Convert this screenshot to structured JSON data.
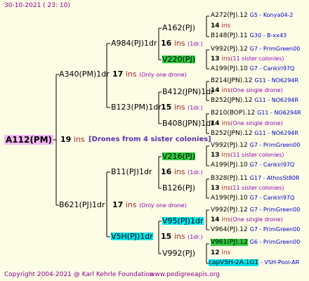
{
  "header": "30-10-2021 ( 23: 10)",
  "footer": {
    "copyright": "Copyright 2004-2021 @ Karl Kehrle Foundation",
    "site": "www.pedigreeapis.org"
  },
  "root": {
    "name": "A112(PM)",
    "inbreed": "19",
    "ins": "ins",
    "desc": "[Drones from 4 sister colonies]"
  },
  "gen1": {
    "top": {
      "name": "A340(PM)1dr",
      "inbreed": "17",
      "ins": "ins",
      "desc": "(Only one drone)"
    },
    "bottom": {
      "name": "B621(PJ)1dr",
      "inbreed": "17",
      "ins": "ins",
      "desc": "(Only one drone)"
    }
  },
  "gen2": {
    "a": {
      "name": "A984(PJ)1dr",
      "inbreed": "16",
      "ins": "ins",
      "desc": "(1dr.)"
    },
    "b": {
      "name": "B123(PM)1dr",
      "inbreed": "15",
      "ins": "ins",
      "desc": "(1dr.)"
    },
    "c": {
      "name": "B11(PJ)1dr",
      "inbreed": "16",
      "ins": "ins",
      "desc": "(1dr.)"
    },
    "d": {
      "name": "V5H(PJ)1dr",
      "inbreed": "15",
      "ins": "ins",
      "desc": "(1dr.)"
    }
  },
  "gen3": [
    {
      "name": "A162(PJ)"
    },
    {
      "name": "V220(PJ)"
    },
    {
      "name": "B412(JPN)1dr"
    },
    {
      "name": "B408(JPN)1dr"
    },
    {
      "name": "V216(PJ)"
    },
    {
      "name": "B126(PJ)"
    },
    {
      "name": "V95(PJ)1dr"
    },
    {
      "name": "V992(PJ)"
    }
  ],
  "gen4": [
    {
      "name": "A272(PJ).12",
      "extra": "G5 - Konya04-2"
    },
    {
      "inbreed": "14",
      "ins": "ins"
    },
    {
      "name": "B148(PJ).11",
      "extra": "G30 - B-xx43"
    },
    {
      "name": "V992(PJ).12",
      "extra": "G7 - PrimGreen00"
    },
    {
      "inbreed": "13",
      "ins": "ins",
      "note": "(11 sister colonies)"
    },
    {
      "name": "A199(PJ).10",
      "extra": "G7 - Cankiri97Q"
    },
    {
      "name": "B214(JPN).12",
      "extra": "G11 - NO6294R"
    },
    {
      "inbreed": "14",
      "ins": "ins",
      "note": "(One single drone)"
    },
    {
      "name": "B252(JPN).12",
      "extra": "G11 - NO6294R"
    },
    {
      "name": "B210(BOP).12",
      "extra": "G11 - NO6294R"
    },
    {
      "inbreed": "14",
      "ins": "ins",
      "note": "(One single drone)"
    },
    {
      "name": "B252(JPN).12",
      "extra": "G11 - NO6294R"
    },
    {
      "name": "V992(PJ).12",
      "extra": "G7 - PrimGreen00"
    },
    {
      "inbreed": "13",
      "ins": "ins",
      "note": "(11 sister colonies)"
    },
    {
      "name": "A199(PJ).10",
      "extra": "G7 - Cankiri97Q"
    },
    {
      "name": "B328(PJ).11",
      "extra": "G17 - AthosSt80R"
    },
    {
      "inbreed": "13",
      "ins": "ins",
      "note": "(11 sister colonies)"
    },
    {
      "name": "A199(PJ).10",
      "extra": "G7 - Cankiri97Q"
    },
    {
      "name": "V992(PJ).12",
      "extra": "G7 - PrimGreen00"
    },
    {
      "inbreed": "14",
      "ins": "ins",
      "note": "(One single drone)"
    },
    {
      "name": "V964(PJ).12",
      "extra": "G7 - PrimGreen00"
    },
    {
      "name": "V961(PJ).12",
      "extra": "G6 - PrimGreen00"
    },
    {
      "inbreed": "12",
      "ins": "ins"
    },
    {
      "name": "capVSH-2A.1G1",
      "extra": "- VSH-Pool-AR"
    }
  ]
}
